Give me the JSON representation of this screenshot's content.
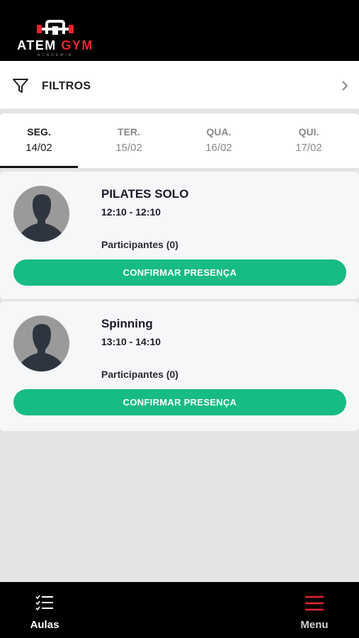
{
  "app": {
    "logo_word1": "ATEM",
    "logo_word2": "GYM",
    "logo_sub": "ACADEMIA"
  },
  "filter": {
    "label": "FILTROS"
  },
  "days": [
    {
      "name": "SEG.",
      "date": "14/02",
      "active": true
    },
    {
      "name": "TER.",
      "date": "15/02",
      "active": false
    },
    {
      "name": "QUA.",
      "date": "16/02",
      "active": false
    },
    {
      "name": "QUI.",
      "date": "17/02",
      "active": false
    }
  ],
  "classes": [
    {
      "name": "PILATES SOLO",
      "time": "12:10 - 12:10",
      "participants": "Participantes (0)",
      "button": "CONFIRMAR PRESENÇA"
    },
    {
      "name": "Spinning",
      "time": "13:10 - 14:10",
      "participants": "Participantes (0)",
      "button": "CONFIRMAR PRESENÇA"
    }
  ],
  "nav": {
    "aulas": "Aulas",
    "menu": "Menu"
  },
  "colors": {
    "accent": "#17bb84",
    "brand_red": "#e3242b",
    "header_bg": "#000000"
  }
}
